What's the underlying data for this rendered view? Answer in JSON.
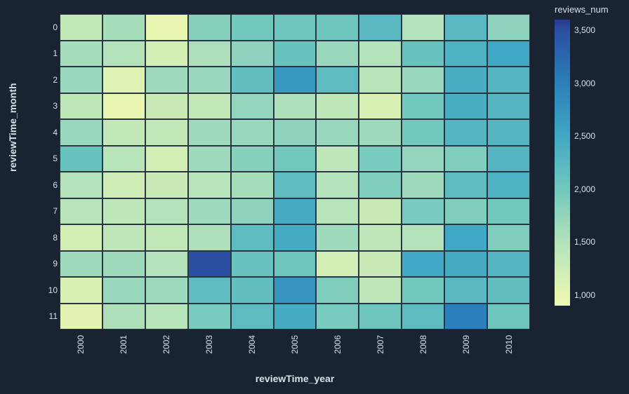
{
  "chart_data": {
    "type": "heatmap",
    "xlabel": "reviewTime_year",
    "ylabel": "reviewTime_month",
    "colorbar_label": "reviews_num",
    "x_categories": [
      "2000",
      "2001",
      "2002",
      "2003",
      "2004",
      "2005",
      "2006",
      "2007",
      "2008",
      "2009",
      "2010"
    ],
    "y_categories": [
      "0",
      "1",
      "2",
      "3",
      "4",
      "5",
      "6",
      "7",
      "8",
      "9",
      "10",
      "11"
    ],
    "color_range": {
      "min": 900,
      "max": 3600
    },
    "colorbar_ticks": [
      "3,500",
      "3,000",
      "2,500",
      "2,000",
      "1,500",
      "1,000"
    ],
    "colorbar_tick_values": [
      3500,
      3000,
      2500,
      2000,
      1500,
      1000
    ],
    "values": [
      [
        1350,
        1600,
        1000,
        1850,
        2000,
        2050,
        2050,
        2250,
        1500,
        2250,
        1800
      ],
      [
        1600,
        1500,
        1200,
        1550,
        1800,
        2100,
        1700,
        1500,
        2100,
        2350,
        2500
      ],
      [
        1700,
        1100,
        1650,
        1700,
        2150,
        2700,
        2200,
        1450,
        1700,
        2400,
        2300
      ],
      [
        1400,
        1000,
        1300,
        1350,
        1750,
        1550,
        1400,
        1150,
        2000,
        2400,
        2300
      ],
      [
        1700,
        1350,
        1350,
        1650,
        1700,
        1800,
        1700,
        1650,
        2000,
        2300,
        2300
      ],
      [
        2100,
        1450,
        1200,
        1650,
        1850,
        2000,
        1400,
        1950,
        1750,
        1900,
        2300
      ],
      [
        1500,
        1250,
        1300,
        1450,
        1600,
        2200,
        1500,
        1900,
        1650,
        2200,
        2350
      ],
      [
        1450,
        1400,
        1500,
        1650,
        1800,
        2450,
        1450,
        1300,
        1950,
        1900,
        2000
      ],
      [
        1200,
        1400,
        1350,
        1550,
        2200,
        2450,
        1650,
        1400,
        1500,
        2500,
        1900
      ],
      [
        1650,
        1650,
        1500,
        3500,
        2100,
        2050,
        1200,
        1300,
        2500,
        2450,
        2300
      ],
      [
        1150,
        1700,
        1650,
        2200,
        2150,
        2750,
        1900,
        1400,
        2000,
        2250,
        2150
      ],
      [
        1050,
        1550,
        1450,
        1950,
        2200,
        2450,
        1950,
        2050,
        2200,
        3000,
        2050
      ]
    ],
    "color_stops": [
      {
        "v": 900,
        "c": "#edf8b4"
      },
      {
        "v": 1000,
        "c": "#e8f6b1"
      },
      {
        "v": 1500,
        "c": "#b3e2bb"
      },
      {
        "v": 2000,
        "c": "#72c8bd"
      },
      {
        "v": 2500,
        "c": "#40a8c4"
      },
      {
        "v": 3000,
        "c": "#2b7fba"
      },
      {
        "v": 3500,
        "c": "#2b4fa2"
      },
      {
        "v": 3600,
        "c": "#2a3a8f"
      }
    ]
  }
}
